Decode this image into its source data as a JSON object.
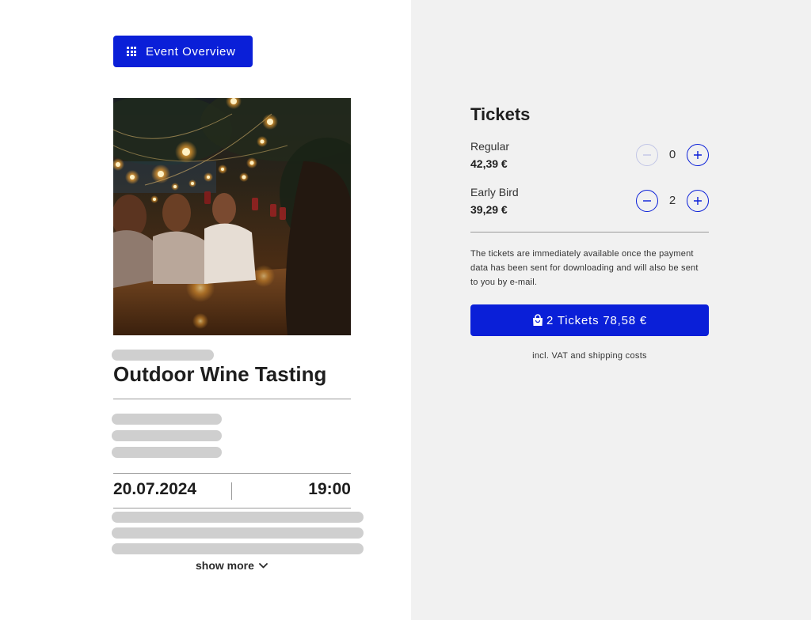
{
  "header": {
    "overview_button_label": "Event Overview",
    "overview_icon": "grid-icon"
  },
  "event": {
    "image_alt": "Friends toasting wine glasses outdoors under string lights",
    "title": "Outdoor Wine Tasting",
    "date": "20.07.2024",
    "time": "19:00",
    "show_more_label": "show more",
    "show_more_icon": "chevron-down-icon"
  },
  "tickets": {
    "heading": "Tickets",
    "types": [
      {
        "name": "Regular",
        "price": "42,39 €",
        "quantity": "0",
        "decrement_disabled": true
      },
      {
        "name": "Early Bird",
        "price": "39,29 €",
        "quantity": "2",
        "decrement_disabled": false
      }
    ],
    "info_text": "The tickets are immediately available once the payment data has been sent for downloading and will also be sent to you by e-mail.",
    "cart_button_label": "2 Tickets 78,58 €",
    "cart_icon": "shopping-bag-icon",
    "vat_note": "incl. VAT and shipping costs"
  },
  "colors": {
    "accent": "#0a1fd8",
    "right_panel_bg": "#f1f1f1",
    "placeholder": "#cfcfcf",
    "text": "#1e1e1e"
  }
}
